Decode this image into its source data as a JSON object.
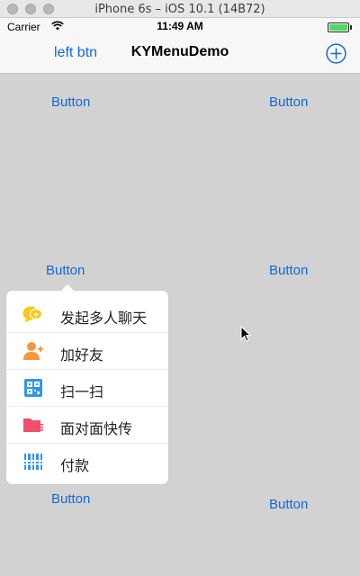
{
  "window": {
    "title": "iPhone 6s – iOS 10.1 (14B72)"
  },
  "status_bar": {
    "carrier": "Carrier",
    "time": "11:49 AM",
    "battery_color": "#4cd964"
  },
  "nav": {
    "left_label": "left btn",
    "title": "KYMenuDemo",
    "add_icon": "plus-circle-icon"
  },
  "content": {
    "buttons": [
      {
        "label": "Button"
      },
      {
        "label": "Button"
      },
      {
        "label": "Button"
      },
      {
        "label": "Button"
      },
      {
        "label": "Button"
      },
      {
        "label": "Button"
      }
    ]
  },
  "menu": {
    "items": [
      {
        "label": "发起多人聊天",
        "icon": "group-chat-icon",
        "color": "#f8c81b"
      },
      {
        "label": "加好友",
        "icon": "add-friend-icon",
        "color": "#f0993f"
      },
      {
        "label": "扫一扫",
        "icon": "scan-qr-icon",
        "color": "#2f97e8"
      },
      {
        "label": "面对面快传",
        "icon": "folder-transfer-icon",
        "color": "#ef4f6c"
      },
      {
        "label": "付款",
        "icon": "barcode-pay-icon",
        "color": "#2f97e8"
      }
    ]
  },
  "theme": {
    "accent": "#1468d8",
    "background": "#d2d2d2"
  }
}
